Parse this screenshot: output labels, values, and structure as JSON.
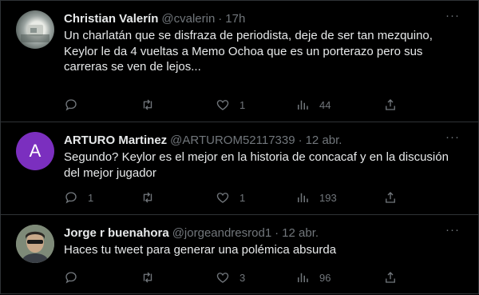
{
  "tweets": [
    {
      "name": "Christian Valerín",
      "handle": "@cvalerin",
      "separator": "·",
      "time": "17h",
      "text": "Un charlatán que se disfraza de periodista, deje de ser tan mezquino,\nKeylor le da 4 vueltas a Memo Ochoa que es un porterazo pero sus\ncarreras se ven de lejos...",
      "replies": "",
      "retweets": "",
      "likes": "1",
      "views": "44"
    },
    {
      "name": "ARTURO Martinez",
      "handle": "@ARTUROM52117339",
      "separator": "·",
      "time": "12 abr.",
      "avatar_letter": "A",
      "text": "Segundo? Keylor es el mejor en la historia de concacaf y en la discusión\ndel mejor jugador",
      "replies": "1",
      "retweets": "",
      "likes": "1",
      "views": "193"
    },
    {
      "name": "Jorge r buenahora",
      "handle": "@jorgeandresrod1",
      "separator": "·",
      "time": "12 abr.",
      "text": "Haces tu tweet para generar una polémica absurda",
      "replies": "",
      "retweets": "",
      "likes": "3",
      "views": "96"
    }
  ],
  "more_label": "···",
  "colors": {
    "background": "#000000",
    "text": "#e7e9ea",
    "muted": "#71767b",
    "border": "#2f3336",
    "avatar_purple": "#7b2fbf"
  },
  "icons": [
    "reply-icon",
    "retweet-icon",
    "like-icon",
    "views-icon",
    "share-icon",
    "more-icon"
  ]
}
